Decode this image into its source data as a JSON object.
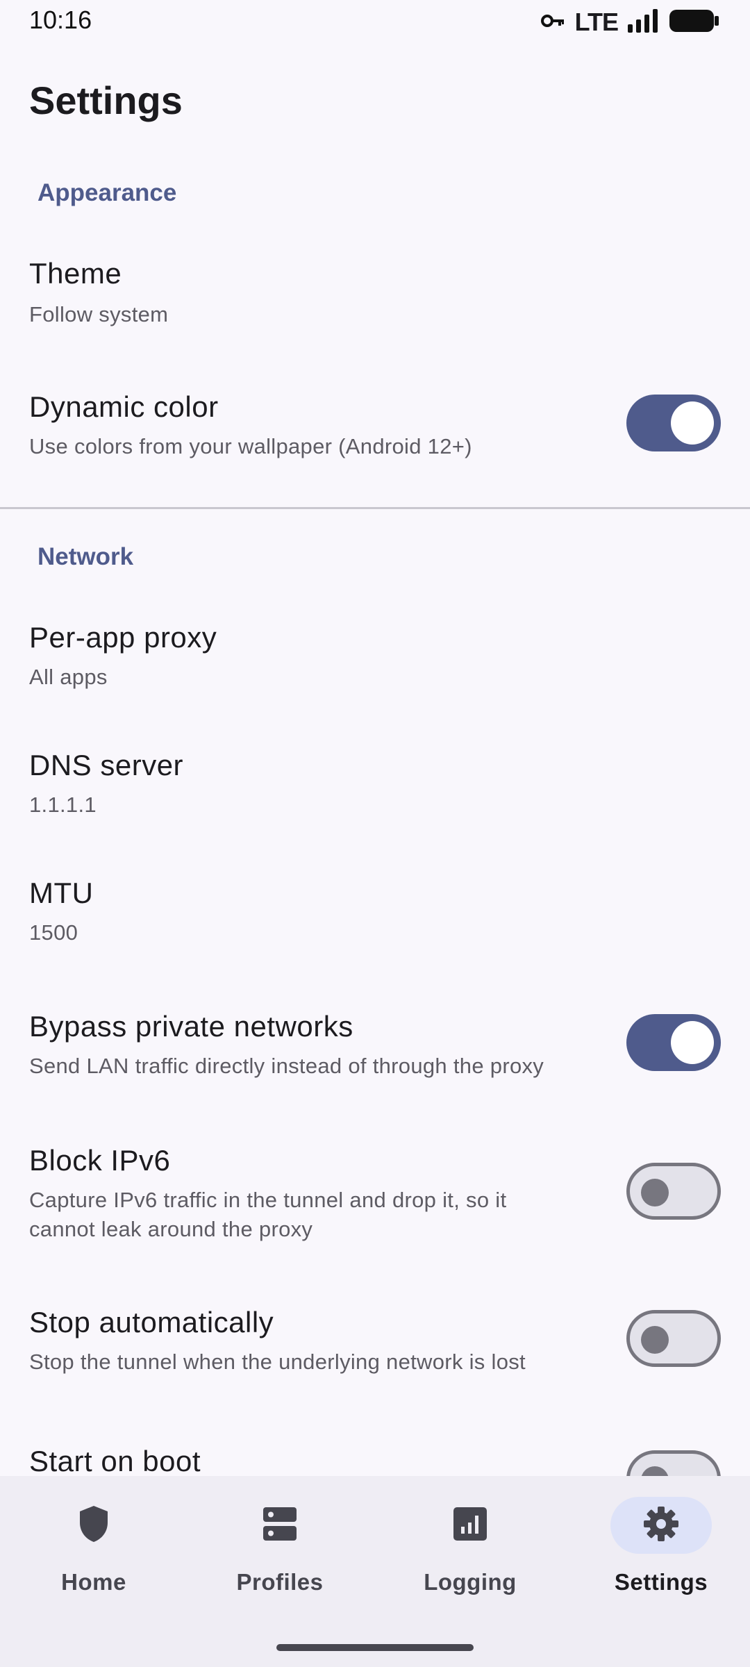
{
  "status_bar": {
    "time": "10:16",
    "network_label": "LTE",
    "icons": [
      "vpn-key-icon",
      "signal-icon",
      "battery-icon"
    ]
  },
  "page": {
    "title": "Settings"
  },
  "sections": {
    "appearance": {
      "header": "Appearance",
      "theme": {
        "title": "Theme",
        "subtitle": "Follow system"
      },
      "dynamic_color": {
        "title": "Dynamic color",
        "subtitle": "Use colors from your wallpaper (Android 12+)",
        "enabled": true
      }
    },
    "network": {
      "header": "Network",
      "per_app_proxy": {
        "title": "Per-app proxy",
        "subtitle": "All apps"
      },
      "dns_server": {
        "title": "DNS server",
        "subtitle": "1.1.1.1"
      },
      "mtu": {
        "title": "MTU",
        "subtitle": "1500"
      },
      "bypass_private": {
        "title": "Bypass private networks",
        "subtitle": "Send LAN traffic directly instead of through the proxy",
        "enabled": true
      },
      "block_ipv6": {
        "title": "Block IPv6",
        "subtitle": "Capture IPv6 traffic in the tunnel and drop it, so it cannot leak around the proxy",
        "enabled": false
      },
      "stop_auto": {
        "title": "Stop automatically",
        "subtitle": "Stop the tunnel when the underlying network is lost",
        "enabled": false
      },
      "start_on_boot": {
        "title": "Start on boot",
        "enabled": false
      }
    }
  },
  "bottom_nav": {
    "items": [
      {
        "label": "Home",
        "icon": "shield-icon"
      },
      {
        "label": "Profiles",
        "icon": "server-icon"
      },
      {
        "label": "Logging",
        "icon": "chart-icon"
      },
      {
        "label": "Settings",
        "icon": "gear-icon",
        "active": true
      }
    ]
  },
  "colors": {
    "accent": "#4f5b8c",
    "background": "#f9f7fc",
    "nav_background": "#efedf4",
    "active_indicator": "#dde2f8"
  }
}
